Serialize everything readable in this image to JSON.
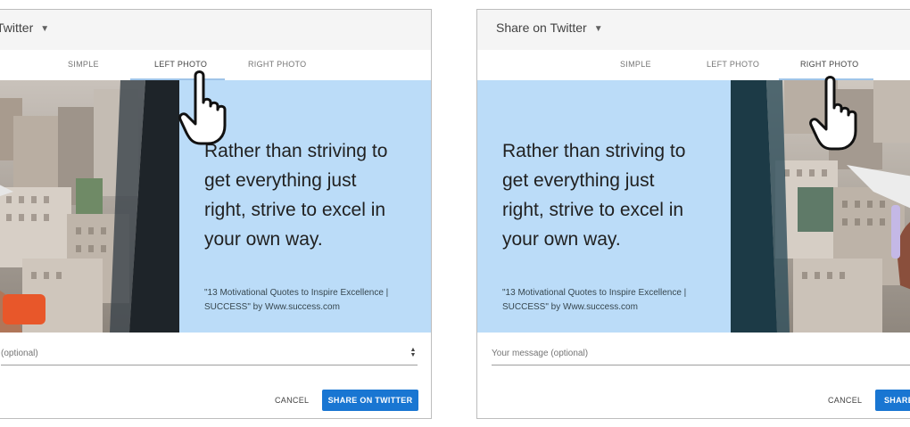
{
  "left_panel": {
    "title": "Twitter",
    "tabs": [
      "SIMPLE",
      "LEFT PHOTO",
      "RIGHT PHOTO"
    ],
    "active_tab": "LEFT PHOTO",
    "quote_lines": [
      "Rather than striving to",
      "get everything just",
      "right, strive to excel in",
      "your own way."
    ],
    "source_lines": [
      "\"13 Motivational Quotes to Inspire Excellence |",
      "SUCCESS\" by Www.success.com"
    ],
    "message_placeholder": "(optional)",
    "cancel_label": "CANCEL",
    "share_label": "SHARE ON TWITTER"
  },
  "right_panel": {
    "title": "Share on Twitter",
    "tabs": [
      "SIMPLE",
      "LEFT PHOTO",
      "RIGHT PHOTO"
    ],
    "active_tab": "RIGHT PHOTO",
    "quote_lines": [
      "Rather than striving to",
      "get everything just",
      "right, strive to excel in",
      "your own way."
    ],
    "source_lines": [
      "\"13 Motivational Quotes to Inspire Excellence |",
      "SUCCESS\" by Www.success.com"
    ],
    "message_placeholder": "Your message (optional)",
    "cancel_label": "CANCEL",
    "share_label": "SHARE"
  },
  "colors": {
    "quote_background": "#bbdcf8",
    "share_button": "#1976d2",
    "tab_indicator": "#9fc4e8"
  },
  "icons": {
    "dropdown": "caret-down-icon",
    "pointer": "hand-pointer-icon",
    "stepper": "spinner-stepper-icon"
  }
}
